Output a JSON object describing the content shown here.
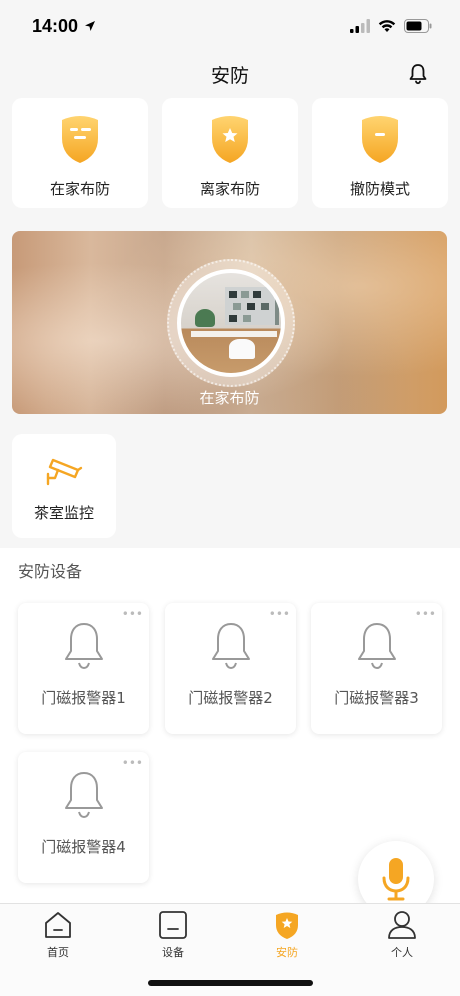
{
  "status_bar": {
    "time": "14:00"
  },
  "nav": {
    "title": "安防"
  },
  "modes": [
    {
      "label": "在家布防",
      "icon": "shield-home-icon"
    },
    {
      "label": "离家布防",
      "icon": "shield-star-icon"
    },
    {
      "label": "撤防模式",
      "icon": "shield-minus-icon"
    }
  ],
  "banner": {
    "label": "在家布防"
  },
  "camera": {
    "label": "茶室监控",
    "icon": "security-camera-icon"
  },
  "devices": {
    "title": "安防设备",
    "items": [
      {
        "label": "门磁报警器1"
      },
      {
        "label": "门磁报警器2"
      },
      {
        "label": "门磁报警器3"
      },
      {
        "label": "门磁报警器4"
      }
    ]
  },
  "tabs": [
    {
      "label": "首页",
      "icon": "home-icon"
    },
    {
      "label": "设备",
      "icon": "device-icon"
    },
    {
      "label": "安防",
      "icon": "shield-star-icon",
      "active": true
    },
    {
      "label": "个人",
      "icon": "person-icon"
    }
  ],
  "colors": {
    "accent": "#f5a623",
    "card": "#ffffff",
    "background": "#f6f6f6"
  }
}
